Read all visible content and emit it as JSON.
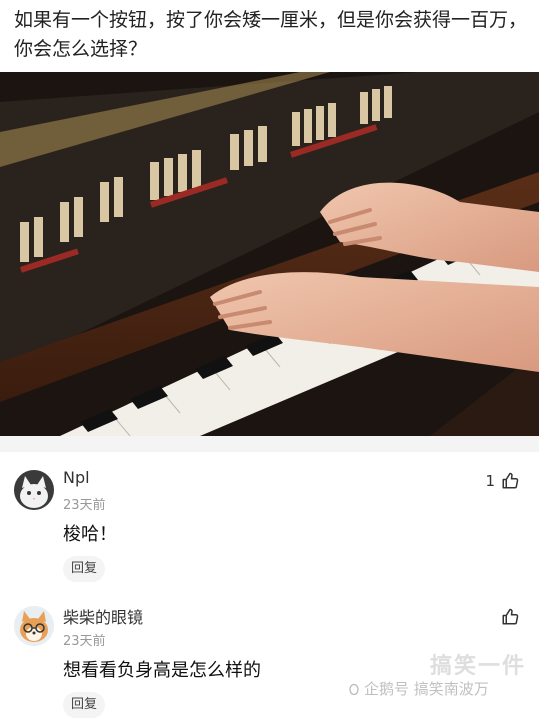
{
  "post": {
    "title": "如果有一个按钮，按了你会矮一厘米，但是你会获得一百万，你会怎么选择？"
  },
  "comments": [
    {
      "user": "Npl",
      "time": "23天前",
      "text": "梭哈！",
      "likes": "1",
      "reply_label": "回复",
      "avatar": "white-cat"
    },
    {
      "user": "柴柴的眼镜",
      "time": "23天前",
      "text": "想看看负身高是怎么样的",
      "likes": "",
      "reply_label": "回复",
      "avatar": "shiba-dog"
    }
  ],
  "watermark": {
    "logo": "搞笑一件",
    "text": "企鹅号 搞笑南波万"
  },
  "icons": [
    "thumb-up-icon",
    "penguin-icon"
  ]
}
